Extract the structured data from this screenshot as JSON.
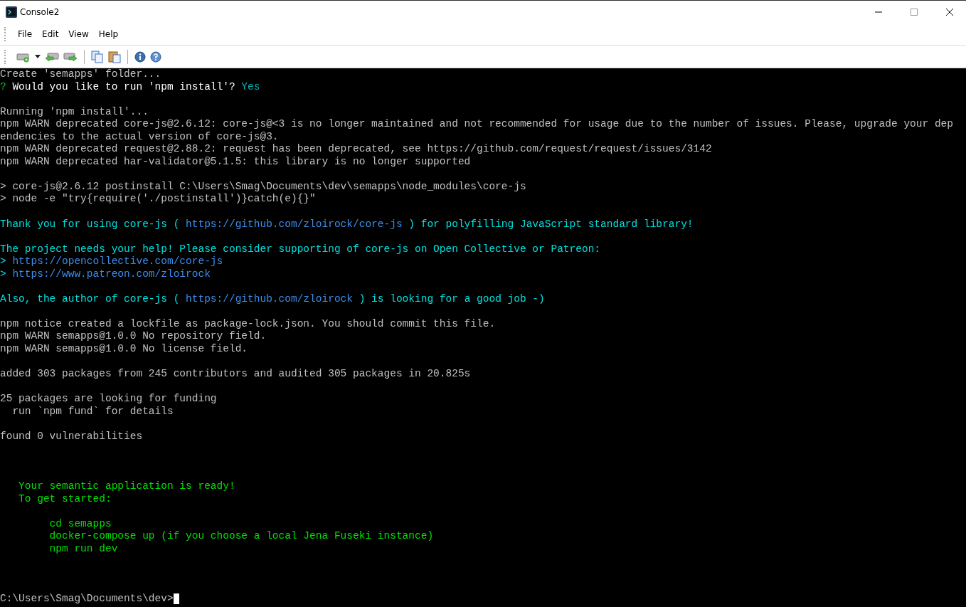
{
  "window": {
    "title": "Console2"
  },
  "menu": [
    {
      "label": "File"
    },
    {
      "label": "Edit"
    },
    {
      "label": "View"
    },
    {
      "label": "Help"
    }
  ],
  "terminal": {
    "lines": [
      {
        "kind": "text",
        "segments": [
          {
            "text": "Create 'semapps' folder...",
            "color": "#c0c0c0"
          }
        ]
      },
      {
        "kind": "text",
        "segments": [
          {
            "text": "?",
            "color": "#00c000"
          },
          {
            "text": " Would you like to run 'npm install'? ",
            "color": "#ffffff"
          },
          {
            "text": "Yes",
            "color": "#00b4b4"
          }
        ]
      },
      {
        "kind": "blank"
      },
      {
        "kind": "text",
        "segments": [
          {
            "text": "Running 'npm install'...",
            "color": "#c0c0c0"
          }
        ]
      },
      {
        "kind": "text",
        "segments": [
          {
            "text": "npm WARN deprecated core-js@2.6.12: core-js@<3 is no longer maintained and not recommended for usage due to the number of issues. Please, upgrade your dep",
            "color": "#c0c0c0"
          }
        ]
      },
      {
        "kind": "text",
        "segments": [
          {
            "text": "endencies to the actual version of core-js@3.",
            "color": "#c0c0c0"
          }
        ]
      },
      {
        "kind": "text",
        "segments": [
          {
            "text": "npm WARN deprecated request@2.88.2: request has been deprecated, see https://github.com/request/request/issues/3142",
            "color": "#c0c0c0"
          }
        ]
      },
      {
        "kind": "text",
        "segments": [
          {
            "text": "npm WARN deprecated har-validator@5.1.5: this library is no longer supported",
            "color": "#c0c0c0"
          }
        ]
      },
      {
        "kind": "blank"
      },
      {
        "kind": "text",
        "segments": [
          {
            "text": "> core-js@2.6.12 postinstall C:\\Users\\Smag\\Documents\\dev\\semapps\\node_modules\\core-js",
            "color": "#c0c0c0"
          }
        ]
      },
      {
        "kind": "text",
        "segments": [
          {
            "text": "> node -e \"try{require('./postinstall')}catch(e){}\"",
            "color": "#c0c0c0"
          }
        ]
      },
      {
        "kind": "blank"
      },
      {
        "kind": "text",
        "segments": [
          {
            "text": "Thank you for using core-js ( ",
            "color": "#00e0e0"
          },
          {
            "text": "https://github.com/zloirock/core-js",
            "color": "#3b8eea"
          },
          {
            "text": " ) for polyfilling JavaScript standard library!",
            "color": "#00e0e0"
          }
        ]
      },
      {
        "kind": "blank"
      },
      {
        "kind": "text",
        "segments": [
          {
            "text": "The project needs your help! Please consider supporting of core-js on Open Collective or Patreon:",
            "color": "#00e0e0"
          }
        ]
      },
      {
        "kind": "text",
        "segments": [
          {
            "text": "> ",
            "color": "#00e0e0"
          },
          {
            "text": "https://opencollective.com/core-js",
            "color": "#3b8eea"
          }
        ]
      },
      {
        "kind": "text",
        "segments": [
          {
            "text": "> ",
            "color": "#00e0e0"
          },
          {
            "text": "https://www.patreon.com/zloirock",
            "color": "#3b8eea"
          }
        ]
      },
      {
        "kind": "blank"
      },
      {
        "kind": "text",
        "segments": [
          {
            "text": "Also, the author of core-js ( ",
            "color": "#00e0e0"
          },
          {
            "text": "https://github.com/zloirock",
            "color": "#3b8eea"
          },
          {
            "text": " ) is looking for a good job -)",
            "color": "#00e0e0"
          }
        ]
      },
      {
        "kind": "blank"
      },
      {
        "kind": "text",
        "segments": [
          {
            "text": "npm notice created a lockfile as package-lock.json. You should commit this file.",
            "color": "#c0c0c0"
          }
        ]
      },
      {
        "kind": "text",
        "segments": [
          {
            "text": "npm WARN semapps@1.0.0 No repository field.",
            "color": "#c0c0c0"
          }
        ]
      },
      {
        "kind": "text",
        "segments": [
          {
            "text": "npm WARN semapps@1.0.0 No license field.",
            "color": "#c0c0c0"
          }
        ]
      },
      {
        "kind": "blank"
      },
      {
        "kind": "text",
        "segments": [
          {
            "text": "added 303 packages from 245 contributors and audited 305 packages in 20.825s",
            "color": "#c0c0c0"
          }
        ]
      },
      {
        "kind": "blank"
      },
      {
        "kind": "text",
        "segments": [
          {
            "text": "25 packages are looking for funding",
            "color": "#c0c0c0"
          }
        ]
      },
      {
        "kind": "text",
        "segments": [
          {
            "text": "  run `npm fund` for details",
            "color": "#c0c0c0"
          }
        ]
      },
      {
        "kind": "blank"
      },
      {
        "kind": "text",
        "segments": [
          {
            "text": "found 0 vulnerabilities",
            "color": "#c0c0c0"
          }
        ]
      },
      {
        "kind": "blank"
      },
      {
        "kind": "blank"
      },
      {
        "kind": "blank"
      },
      {
        "kind": "text",
        "segments": [
          {
            "text": "   Your semantic application is ready!",
            "color": "#00e000"
          }
        ]
      },
      {
        "kind": "text",
        "segments": [
          {
            "text": "   To get started:",
            "color": "#00e000"
          }
        ]
      },
      {
        "kind": "blank"
      },
      {
        "kind": "text",
        "segments": [
          {
            "text": "        cd semapps",
            "color": "#00e000"
          }
        ]
      },
      {
        "kind": "text",
        "segments": [
          {
            "text": "        docker-compose up (if you choose a local Jena Fuseki instance)",
            "color": "#00e000"
          }
        ]
      },
      {
        "kind": "text",
        "segments": [
          {
            "text": "        npm run dev",
            "color": "#00e000"
          }
        ]
      },
      {
        "kind": "blank"
      },
      {
        "kind": "blank"
      },
      {
        "kind": "blank"
      }
    ],
    "prompt": "C:\\Users\\Smag\\Documents\\dev>"
  }
}
